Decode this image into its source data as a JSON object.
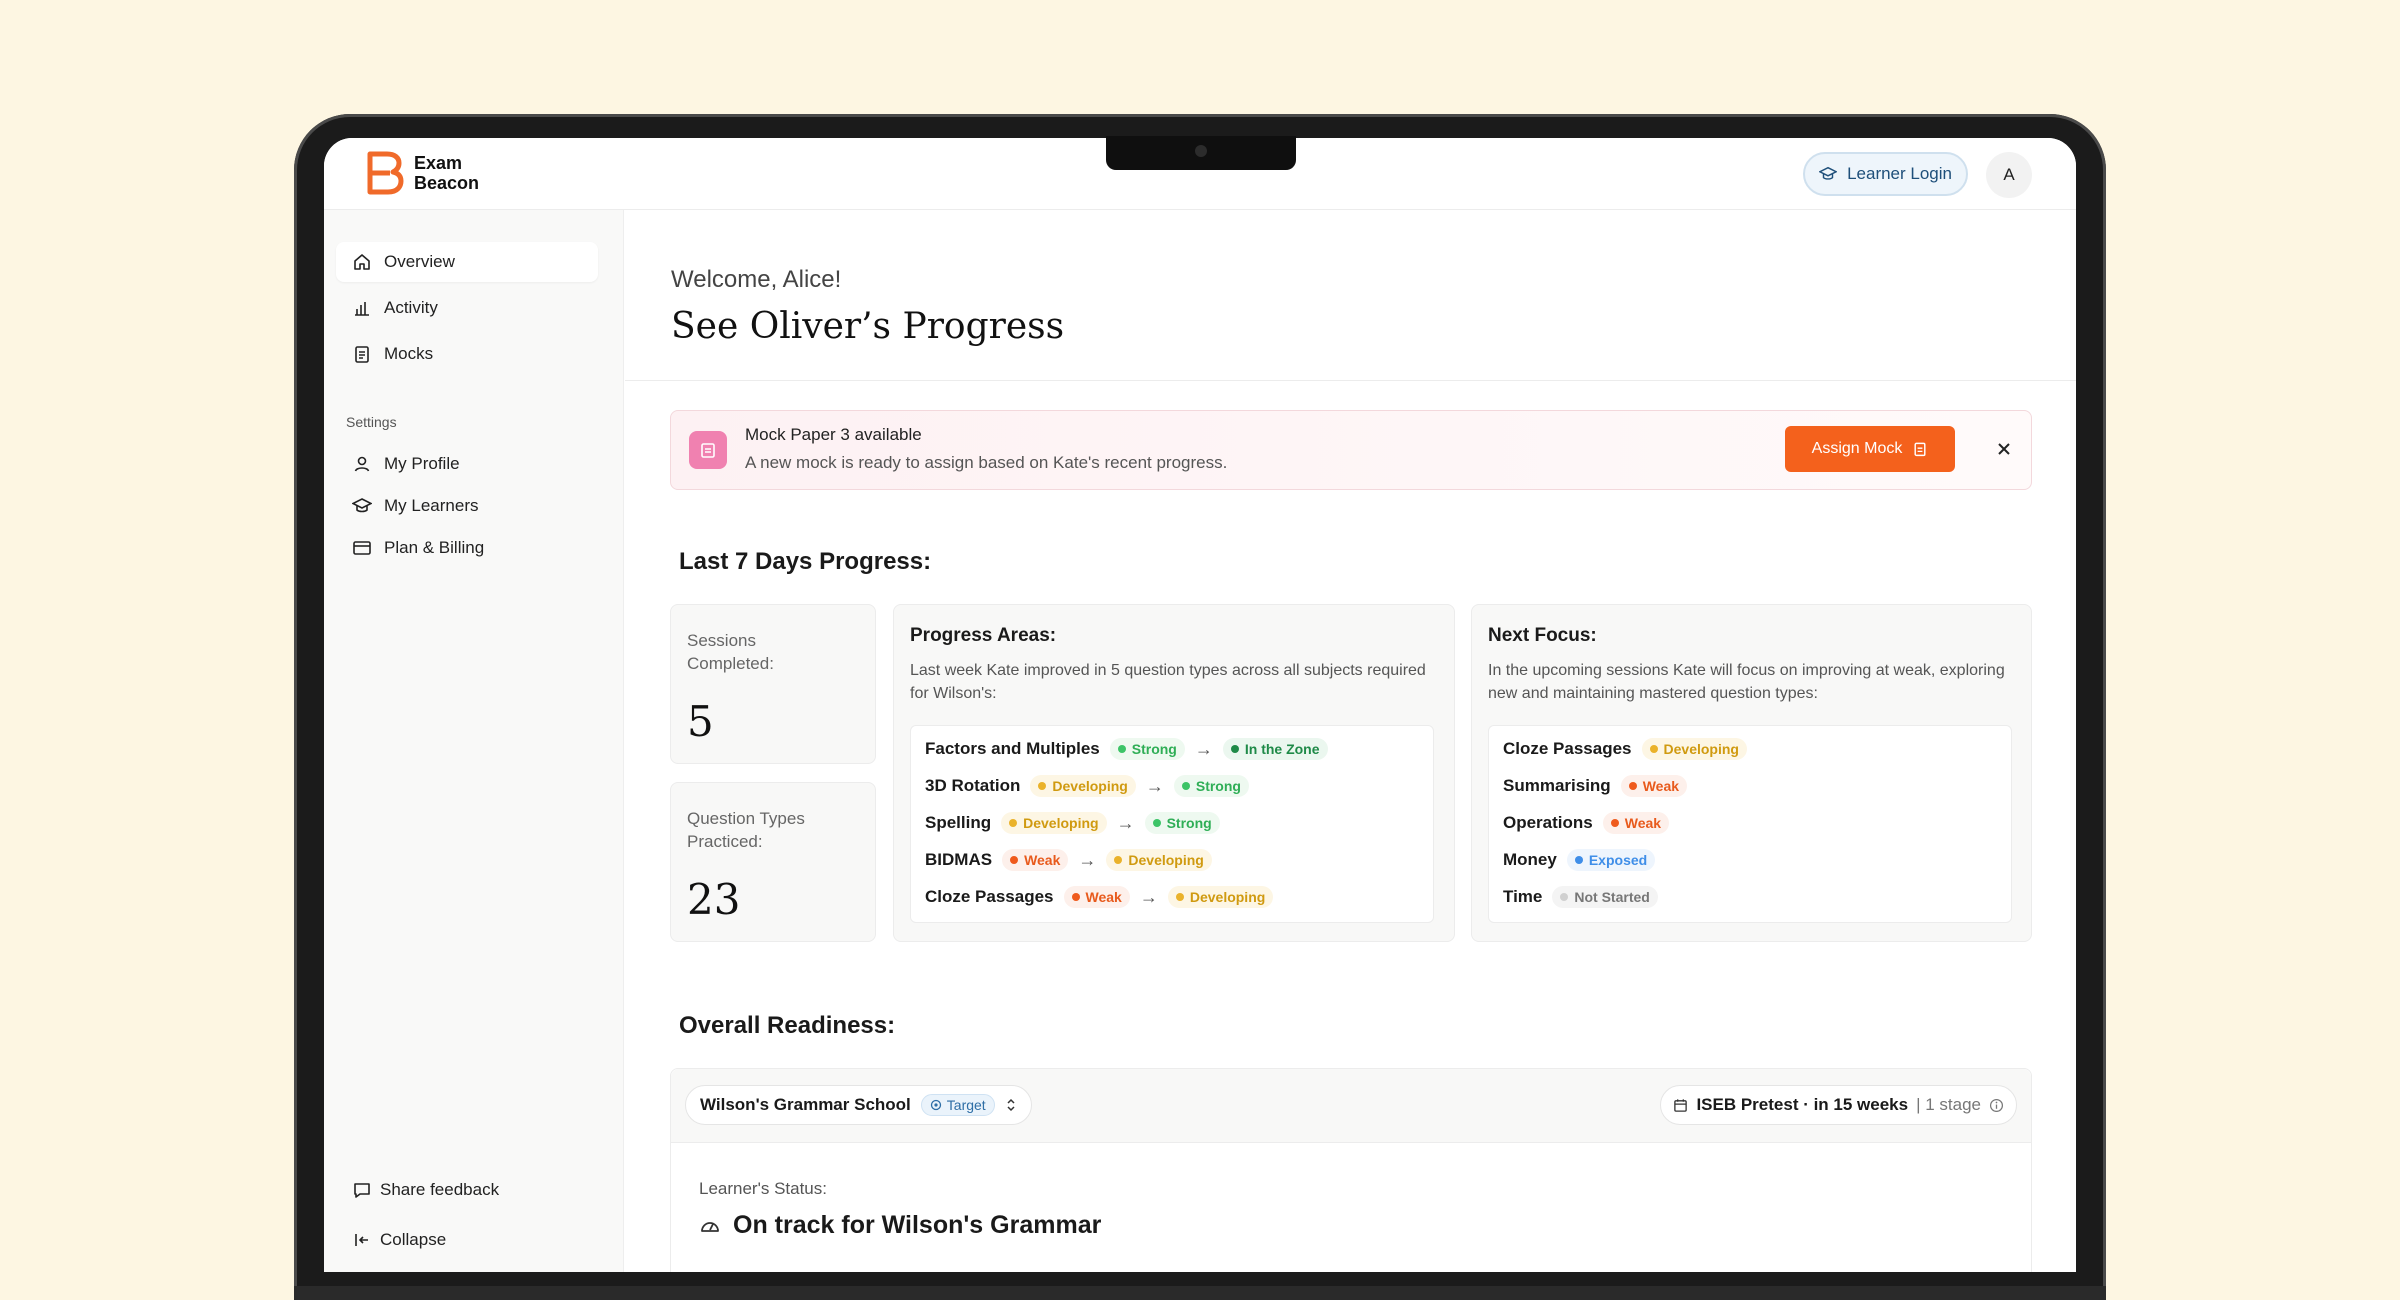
{
  "app": {
    "logo_line1": "Exam",
    "logo_line2": "Beacon",
    "learner_login": "Learner Login",
    "avatar_initial": "A"
  },
  "sidebar": {
    "items": [
      {
        "label": "Overview",
        "icon": "home-icon"
      },
      {
        "label": "Activity",
        "icon": "bar-chart-icon"
      },
      {
        "label": "Mocks",
        "icon": "clipboard-icon"
      }
    ],
    "settings_heading": "Settings",
    "settings_items": [
      {
        "label": "My Profile",
        "icon": "user-icon"
      },
      {
        "label": "My Learners",
        "icon": "graduation-cap-icon"
      },
      {
        "label": "Plan & Billing",
        "icon": "credit-card-icon"
      }
    ],
    "share_feedback": "Share feedback",
    "collapse": "Collapse"
  },
  "main": {
    "welcome": "Welcome, Alice!",
    "title": "See Oliver’s Progress",
    "alert": {
      "title": "Mock Paper 3 available",
      "subtitle": "A new mock is ready to assign based on Kate's recent progress.",
      "button": "Assign Mock"
    },
    "progress_heading": "Last 7 Days Progress:",
    "sessions": {
      "label": "Sessions Completed:",
      "value": "5"
    },
    "question_types": {
      "label": "Question Types Practiced:",
      "value": "23"
    },
    "progress_areas": {
      "title": "Progress Areas:",
      "subtitle": "Last week Kate improved in 5 question types across all subjects required for Wilson's:",
      "rows": [
        {
          "name": "Factors and Multiples",
          "from": "Strong",
          "to": "In the Zone"
        },
        {
          "name": "3D Rotation",
          "from": "Developing",
          "to": "Strong"
        },
        {
          "name": "Spelling",
          "from": "Developing",
          "to": "Strong"
        },
        {
          "name": "BIDMAS",
          "from": "Weak",
          "to": "Developing"
        },
        {
          "name": "Cloze Passages",
          "from": "Weak",
          "to": "Developing"
        }
      ]
    },
    "next_focus": {
      "title": "Next Focus:",
      "subtitle": "In the upcoming sessions Kate will focus on improving at weak, exploring new and maintaining mastered question types:",
      "rows": [
        {
          "name": "Cloze Passages",
          "status": "Developing"
        },
        {
          "name": "Summarising",
          "status": "Weak"
        },
        {
          "name": "Operations",
          "status": "Weak"
        },
        {
          "name": "Money",
          "status": "Exposed"
        },
        {
          "name": "Time",
          "status": "Not Started"
        }
      ]
    },
    "readiness_heading": "Overall Readiness:",
    "readiness": {
      "school": "Wilson's Grammar School",
      "target": "Target",
      "exam": "ISEB Pretest · in 15 weeks",
      "stage": "| 1 stage",
      "learner_status_label": "Learner's Status:",
      "status": "On track for Wilson's Grammar"
    }
  }
}
